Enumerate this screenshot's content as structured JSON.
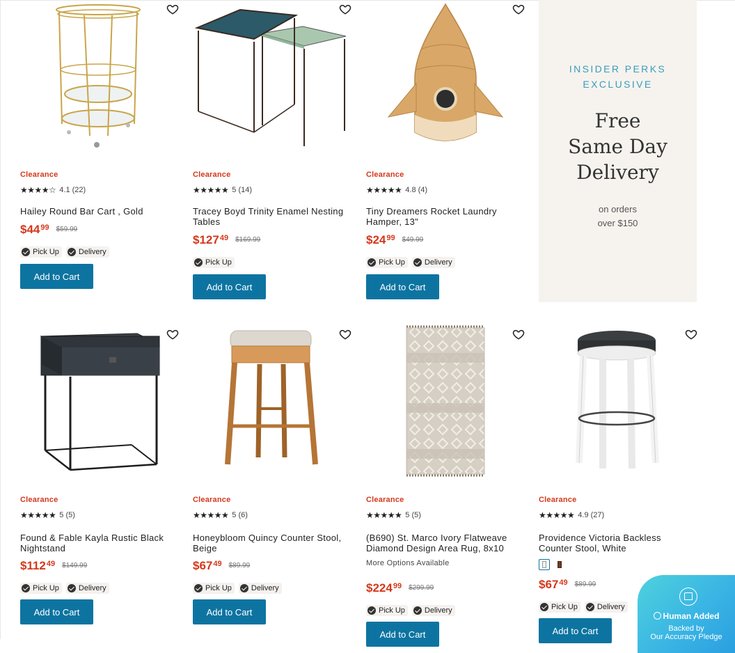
{
  "promo": {
    "eyebrow_line1": "INSIDER PERKS",
    "eyebrow_line2": "EXCLUSIVE",
    "headline_line1": "Free",
    "headline_line2": "Same Day",
    "headline_line3": "Delivery",
    "sub_line1": "on orders",
    "sub_line2": "over $150"
  },
  "products": [
    {
      "badge": "Clearance",
      "stars": "★★★★☆",
      "rating": "4.1 (22)",
      "name": "Hailey Round Bar Cart , Gold",
      "price_dollars": "$44",
      "price_cents": "99",
      "was": "$59.99",
      "pickup": "Pick Up",
      "delivery": "Delivery",
      "cart": "Add to Cart"
    },
    {
      "badge": "Clearance",
      "stars": "★★★★★",
      "rating": "5 (14)",
      "name": "Tracey Boyd Trinity Enamel Nesting Tables",
      "price_dollars": "$127",
      "price_cents": "49",
      "was": "$169.99",
      "pickup": "Pick Up",
      "cart": "Add to Cart"
    },
    {
      "badge": "Clearance",
      "stars": "★★★★★",
      "rating": "4.8 (4)",
      "name": "Tiny Dreamers Rocket Laundry Hamper, 13\"",
      "price_dollars": "$24",
      "price_cents": "99",
      "was": "$49.99",
      "pickup": "Pick Up",
      "delivery": "Delivery",
      "cart": "Add to Cart"
    },
    {
      "badge": "Clearance",
      "stars": "★★★★★",
      "rating": "5 (5)",
      "name": "Found & Fable Kayla Rustic Black Nightstand",
      "price_dollars": "$112",
      "price_cents": "49",
      "was": "$149.99",
      "pickup": "Pick Up",
      "delivery": "Delivery",
      "cart": "Add to Cart"
    },
    {
      "badge": "Clearance",
      "stars": "★★★★★",
      "rating": "5 (6)",
      "name": "Honeybloom Quincy Counter Stool, Beige",
      "price_dollars": "$67",
      "price_cents": "49",
      "was": "$89.99",
      "pickup": "Pick Up",
      "delivery": "Delivery",
      "cart": "Add to Cart"
    },
    {
      "badge": "Clearance",
      "stars": "★★★★★",
      "rating": "5 (5)",
      "name": "(B690) St. Marco Ivory Flatweave Diamond Design Area Rug, 8x10",
      "options": "More Options Available",
      "price_dollars": "$224",
      "price_cents": "99",
      "was": "$299.99",
      "pickup": "Pick Up",
      "delivery": "Delivery",
      "cart": "Add to Cart"
    },
    {
      "badge": "Clearance",
      "stars": "★★★★★",
      "rating": "4.9 (27)",
      "name": "Providence Victoria Backless Counter Stool, White",
      "price_dollars": "$67",
      "price_cents": "49",
      "was": "$89.99",
      "pickup": "Pick Up",
      "delivery": "Delivery",
      "cart": "Add to Cart"
    }
  ],
  "pledge": {
    "title": "Human Added",
    "line1": "Backed by",
    "line2": "Our Accuracy Pledge"
  },
  "colors": {
    "accent_blue": "#0d74a1",
    "clearance_red": "#d4381c",
    "promo_bg": "#f6f3ee",
    "promo_eyebrow": "#3a9cbc"
  }
}
